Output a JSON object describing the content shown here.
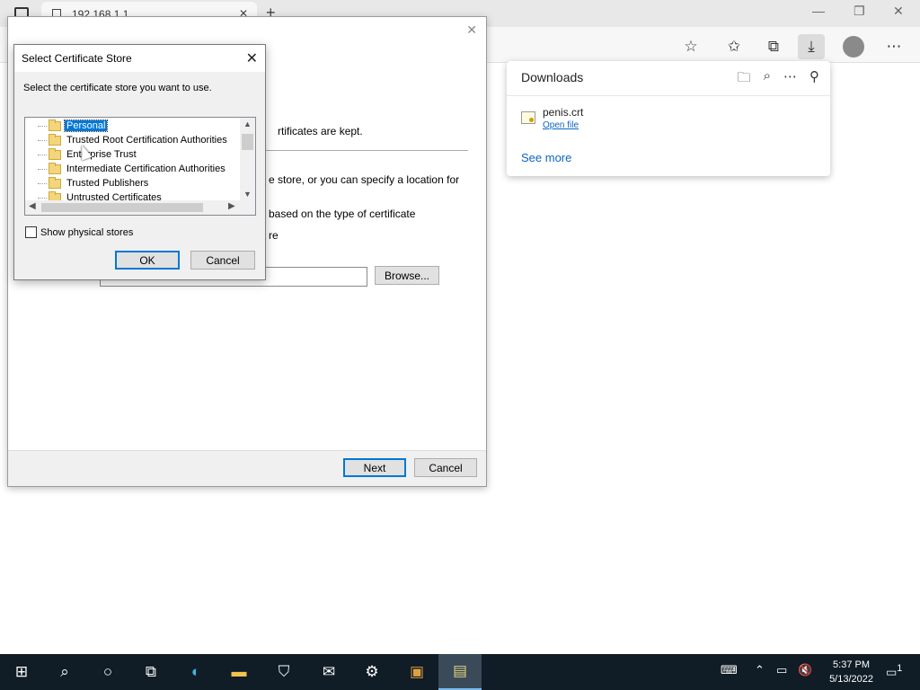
{
  "browser": {
    "tab_title": "192.168.1.1",
    "tab_close": "✕",
    "new_tab": "+",
    "window_controls": {
      "minimize": "—",
      "restore": "❐",
      "close": "✕"
    },
    "toolbar_icons": [
      "add-favorite-icon",
      "favorites-icon",
      "collections-icon",
      "downloads-icon",
      "profile-avatar",
      "more-icon"
    ]
  },
  "downloads": {
    "title": "Downloads",
    "file_name": "penis.crt",
    "open_file": "Open file",
    "see_more": "See more"
  },
  "wizard": {
    "close": "✕",
    "line1": "rtificates are kept.",
    "line2": "e store, or you can specify a location for",
    "line3": "based on the type of certificate",
    "line4": "re",
    "browse_label": "Browse...",
    "next_label": "Next",
    "cancel_label": "Cancel"
  },
  "dialog": {
    "title": "Select Certificate Store",
    "close": "✕",
    "prompt": "Select the certificate store you want to use.",
    "stores": [
      "Personal",
      "Trusted Root Certification Authorities",
      "Enterprise Trust",
      "Intermediate Certification Authorities",
      "Trusted Publishers",
      "Untrusted Certificates"
    ],
    "selected_store": "Personal",
    "show_physical": "Show physical stores",
    "show_physical_checked": false,
    "ok_label": "OK",
    "cancel_label": "Cancel"
  },
  "taskbar": {
    "items": [
      "start",
      "search",
      "cortana",
      "task-view",
      "edge",
      "file-explorer",
      "store",
      "mail",
      "settings",
      "certificate-manager",
      "certificate-wizard"
    ],
    "time": "5:37 PM",
    "date": "5/13/2022",
    "notification_count": "1"
  },
  "colors": {
    "accent": "#0078d7",
    "link": "#0a66c2",
    "taskbar": "#101c26"
  }
}
